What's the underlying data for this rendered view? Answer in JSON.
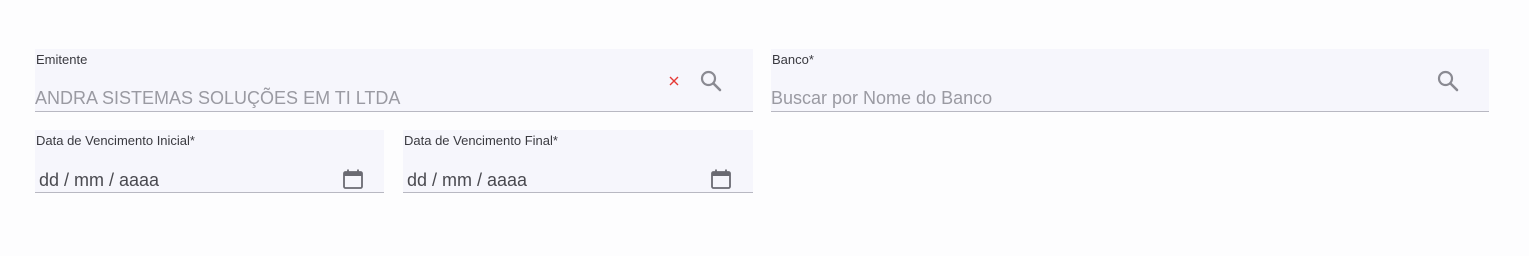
{
  "emitente": {
    "label": "Emitente",
    "value": "ANDRA SISTEMAS SOLUÇÕES EM TI LTDA",
    "clear_icon": "close-icon",
    "search_icon": "search-icon"
  },
  "banco": {
    "label": "Banco*",
    "placeholder": "Buscar por Nome do Banco",
    "search_icon": "search-icon"
  },
  "data_inicial": {
    "label": "Data de Vencimento Inicial*",
    "value": "dd / mm / aaaa",
    "icon": "calendar-icon"
  },
  "data_final": {
    "label": "Data de Vencimento Final*",
    "value": "dd / mm / aaaa",
    "icon": "calendar-icon"
  },
  "colors": {
    "field_bg": "#f6f6fc",
    "clear_icon": "#e53935",
    "icon_gray": "#8a8a92"
  }
}
